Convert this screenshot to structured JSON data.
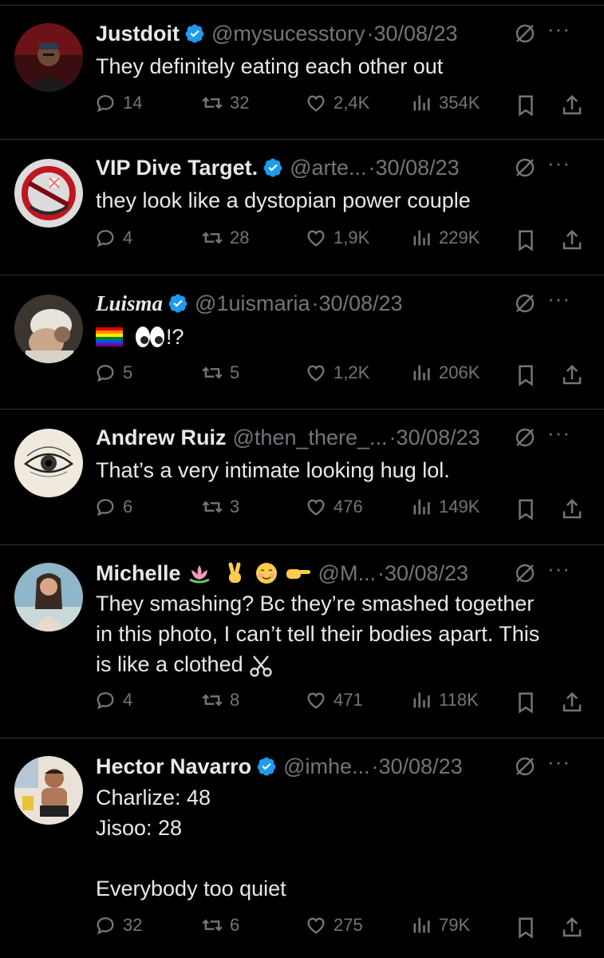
{
  "colors": {
    "background": "#000000",
    "text": "#e7e9ea",
    "muted": "#71767b",
    "divider": "#2f3336",
    "verified": "#1d9bf0"
  },
  "replies": [
    {
      "name": "Justdoit",
      "verified": true,
      "handle": "@mysucesstory",
      "date": "·30/08/23",
      "text": "They definitely eating each other out",
      "stats": {
        "replies": "14",
        "retweets": "32",
        "likes": "2,4K",
        "views": "354K"
      }
    },
    {
      "name": "VIP Dive Target.",
      "verified": true,
      "handle": "@arte...",
      "date": "·30/08/23",
      "text": "they look like a dystopian power couple",
      "stats": {
        "replies": "4",
        "retweets": "28",
        "likes": "1,9K",
        "views": "229K"
      }
    },
    {
      "name": "Luisma",
      "verified": true,
      "handle": "@1uismaria",
      "date": "·30/08/23",
      "text": "!?",
      "stats": {
        "replies": "5",
        "retweets": "5",
        "likes": "1,2K",
        "views": "206K"
      }
    },
    {
      "name": "Andrew Ruiz",
      "verified": false,
      "handle": "@then_there_...",
      "date": "·30/08/23",
      "text": "That’s a very intimate looking hug lol.",
      "stats": {
        "replies": "6",
        "retweets": "3",
        "likes": "476",
        "views": "149K"
      }
    },
    {
      "name": "Michelle",
      "verified": false,
      "handle": "@M...",
      "date": "·30/08/23",
      "text": "They smashing? Bc they’re smashed together\nin this photo, I can’t tell their bodies apart. This\nis like a clothed",
      "stats": {
        "replies": "4",
        "retweets": "8",
        "likes": "471",
        "views": "118K"
      }
    },
    {
      "name": "Hector Navarro",
      "verified": true,
      "handle": "@imhe...",
      "date": "·30/08/23",
      "text": "Charlize: 48\nJisoo: 28\n\nEverybody too quiet",
      "stats": {
        "replies": "32",
        "retweets": "6",
        "likes": "275",
        "views": "79K"
      }
    }
  ],
  "more_label": "···"
}
